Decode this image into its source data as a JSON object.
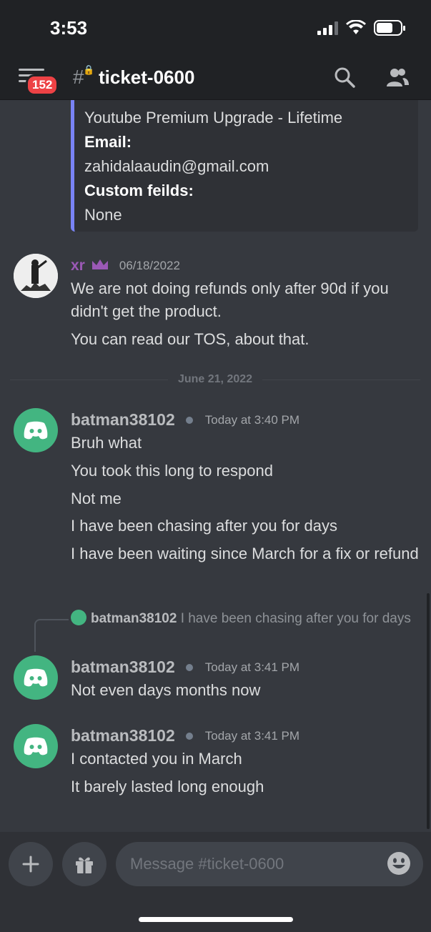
{
  "status_bar": {
    "time": "3:53"
  },
  "header": {
    "unread_badge": "152",
    "channel_name": "ticket-0600"
  },
  "embed": {
    "lines": [
      {
        "text": "Youtube Premium Upgrade - Lifetime",
        "bold": false
      },
      {
        "text": "Email:",
        "bold": true
      },
      {
        "text": "zahidalaaudin@gmail.com",
        "bold": false
      },
      {
        "text": "Custom feilds:",
        "bold": true
      },
      {
        "text": "None",
        "bold": false
      }
    ]
  },
  "messages": [
    {
      "author": "xr",
      "timestamp": "06/18/2022",
      "lines": [
        "We are not doing refunds only after 90d if you didn't get the product.",
        "You can read our TOS, about that."
      ]
    },
    {
      "author": "batman38102",
      "timestamp": "Today at 3:40 PM",
      "lines": [
        "Bruh what",
        "You took this long to respond",
        "Not me",
        "I have been chasing after you for days",
        "I have been waiting since March for a fix or refund"
      ]
    },
    {
      "author": "batman38102",
      "timestamp": "Today at 3:41 PM",
      "reply_to": {
        "author": "batman38102",
        "text": "I have been chasing after you for days"
      },
      "lines": [
        "Not even days months now"
      ]
    },
    {
      "author": "batman38102",
      "timestamp": "Today at 3:41 PM",
      "lines": [
        "I contacted you in March",
        "It barely lasted long enough"
      ]
    }
  ],
  "date_divider": "June 21, 2022",
  "composer": {
    "placeholder": "Message #ticket-0600"
  },
  "colors": {
    "accent": "#7983f5",
    "green_avatar": "#43b581",
    "badge": "#ed4245",
    "role_purple": "#9b59b6"
  }
}
